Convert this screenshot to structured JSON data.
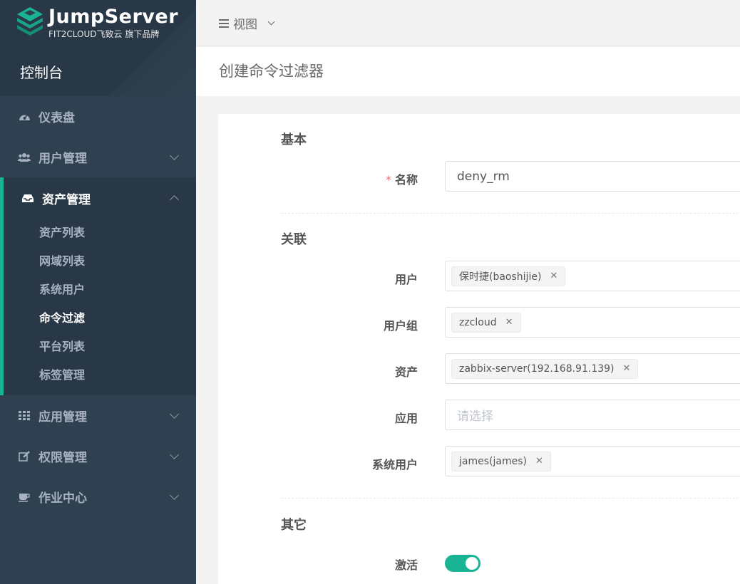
{
  "brand": {
    "name": "JumpServer",
    "tagline": "FIT2CLOUD飞致云 旗下品牌",
    "console": "控制台"
  },
  "sidebar": {
    "items": [
      {
        "label": "仪表盘",
        "icon": "dashboard-icon"
      },
      {
        "label": "用户管理",
        "icon": "users-icon"
      },
      {
        "label": "资产管理",
        "icon": "inbox-icon",
        "expanded": true
      },
      {
        "label": "应用管理",
        "icon": "grid-icon"
      },
      {
        "label": "权限管理",
        "icon": "edit-icon"
      },
      {
        "label": "作业中心",
        "icon": "coffee-icon"
      }
    ],
    "asset_sub": [
      "资产列表",
      "网域列表",
      "系统用户",
      "命令过滤",
      "平台列表",
      "标签管理"
    ],
    "active_sub": "命令过滤"
  },
  "topbar": {
    "view_label": "视图"
  },
  "page": {
    "title": "创建命令过滤器"
  },
  "form": {
    "sections": {
      "basic": "基本",
      "relation": "关联",
      "other": "其它"
    },
    "name": {
      "label": "名称",
      "value": "deny_rm"
    },
    "users": {
      "label": "用户",
      "tags": [
        "保时捷(baoshijie)"
      ]
    },
    "user_groups": {
      "label": "用户组",
      "tags": [
        "zzcloud"
      ]
    },
    "assets": {
      "label": "资产",
      "tags": [
        "zabbix-server(192.168.91.139)"
      ]
    },
    "applications": {
      "label": "应用",
      "placeholder": "请选择"
    },
    "system_users": {
      "label": "系统用户",
      "tags": [
        "james(james)"
      ]
    },
    "active": {
      "label": "激活",
      "value": true
    }
  },
  "colors": {
    "sidebar_bg": "#2f4050",
    "accent": "#1ab394",
    "required": "#f56c6c"
  }
}
